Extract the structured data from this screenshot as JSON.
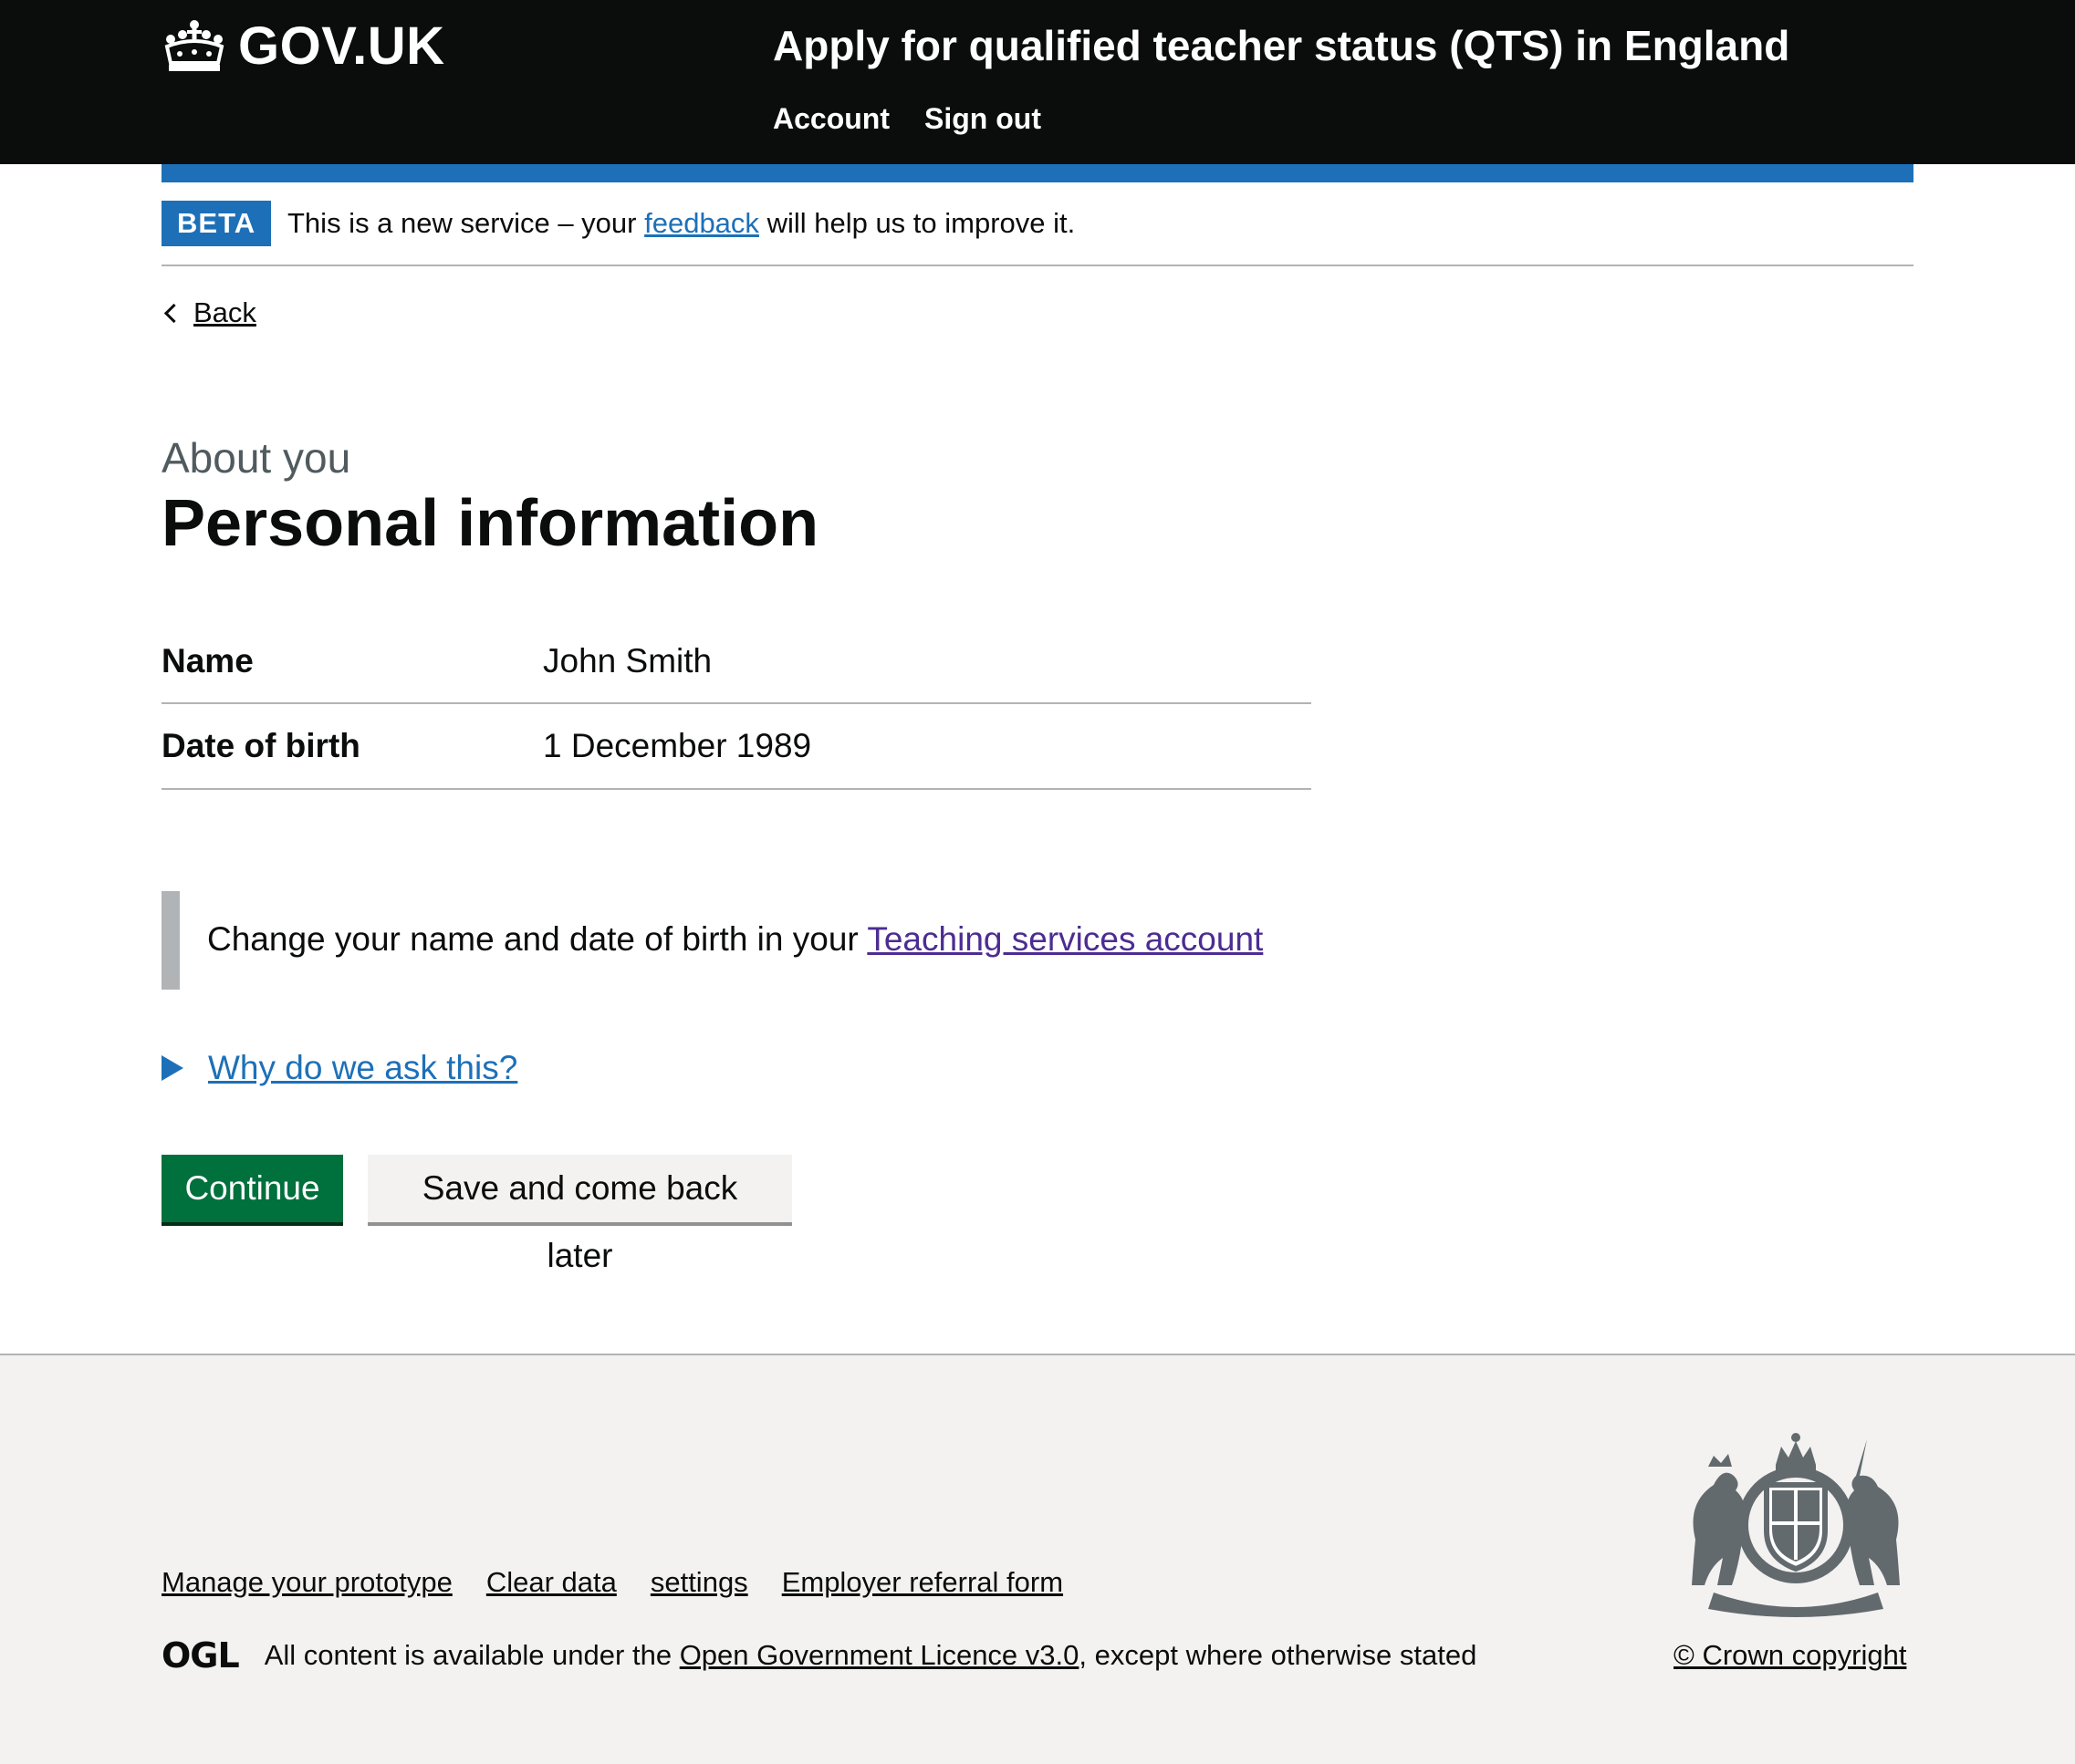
{
  "header": {
    "logo_text": "GOV.UK",
    "service_name": "Apply for qualified teacher status (QTS) in England",
    "nav": [
      "Account",
      "Sign out"
    ]
  },
  "phase_banner": {
    "tag": "BETA",
    "text_before": "This is a new service – your",
    "link": "feedback",
    "text_after": "will help us to improve it."
  },
  "back_link": "Back",
  "caption": "About you",
  "title": "Personal information",
  "summary": [
    {
      "key": "Name",
      "value": "John Smith"
    },
    {
      "key": "Date of birth",
      "value": "1 December 1989"
    }
  ],
  "inset": {
    "text": "Change your name and date of birth in your",
    "link": "Teaching services account"
  },
  "details_summary": "Why do we ask this?",
  "buttons": {
    "continue": "Continue",
    "save": "Save and come back later"
  },
  "footer": {
    "links": [
      "Manage your prototype",
      "Clear data",
      "settings",
      "Employer referral form"
    ],
    "ogl": "OGL",
    "licence_before": "All content is available under the",
    "licence_link": "Open Government Licence v3.0",
    "licence_after": ", except where otherwise stated",
    "copyright": "© Crown copyright"
  },
  "colors": {
    "header_bg": "#0b0c0c",
    "brand_blue": "#1d70b8",
    "button_green": "#00703c",
    "visited_link": "#4c2c92",
    "footer_bg": "#f3f2f1"
  }
}
